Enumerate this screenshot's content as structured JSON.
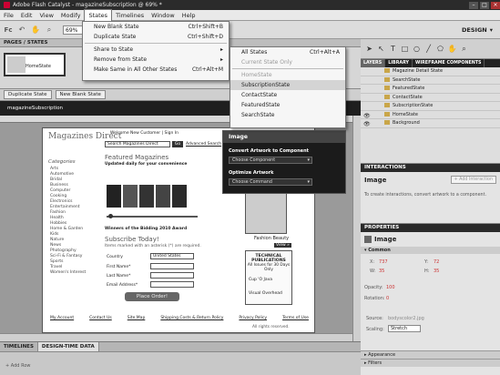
{
  "title_bar": {
    "text": "Adobe Flash Catalyst - magazineSubscription @ 69% *"
  },
  "menu": [
    "File",
    "Edit",
    "View",
    "Modify",
    "States",
    "Timelines",
    "Window",
    "Help"
  ],
  "toolbar": {
    "zoom": "69%"
  },
  "workspace": {
    "label": "DESIGN"
  },
  "pages_panel": {
    "title": "PAGES / STATES",
    "thumb_label": "HomeState",
    "duplicate_label": "Duplicate State",
    "new_blank_label": "New Blank State"
  },
  "breadcrumb": {
    "text": "magazineSubscription"
  },
  "states_menu": {
    "items": [
      {
        "label": "New Blank State",
        "shortcut": "Ctrl+Shift+B"
      },
      {
        "label": "Duplicate State",
        "shortcut": "Ctrl+Shift+D"
      },
      {
        "label": "Share to State",
        "shortcut": "▸"
      },
      {
        "label": "Remove from State",
        "shortcut": "▸"
      },
      {
        "label": "Make Same in All Other States",
        "shortcut": "Ctrl+Alt+M"
      }
    ]
  },
  "share_submenu": {
    "items": [
      {
        "label": "All States",
        "shortcut": "Ctrl+Alt+A"
      },
      {
        "label": "Current State Only",
        "shortcut": ""
      },
      {
        "label": "HomeState",
        "shortcut": ""
      },
      {
        "label": "SubscriptionState",
        "shortcut": ""
      },
      {
        "label": "ContactState",
        "shortcut": ""
      },
      {
        "label": "FeaturedState",
        "shortcut": ""
      },
      {
        "label": "SearchState",
        "shortcut": ""
      }
    ]
  },
  "hud": {
    "title": "Image",
    "convert_label": "Convert Artwork to Component",
    "convert_select": "Choose Component",
    "optimize_label": "Optimize Artwork",
    "optimize_select": "Choose Command"
  },
  "canvas": {
    "logo": "Magazines Direct",
    "welcome": "Welcome  New Customer | Sign In",
    "search_placeholder": "Search Magazines Direct",
    "go": "Go",
    "advanced": "Advanced Search",
    "featured": "Featured Magazines",
    "featured_sub": "Updated daily for your convenience",
    "categories_title": "Categories",
    "categories": [
      "Arts",
      "Automotive",
      "Bridal",
      "Business",
      "Computer",
      "Cooking",
      "Electronics",
      "Entertainment",
      "Fashion",
      "Health",
      "Hobbies",
      "Home & Garden",
      "Kids",
      "Nature",
      "News",
      "Photography",
      "Sci-Fi & Fantasy",
      "Sports",
      "Travel",
      "Women's Interest"
    ],
    "subscribe_title": "Subscribe Today!",
    "subscribe_note": "Items marked with an asterisk (*) are required.",
    "country_label": "Country",
    "country_value": "United States",
    "first_label": "First Name*",
    "last_label": "Last Name*",
    "email_label": "Email Address*",
    "order_btn": "Place Order!",
    "winner": "Winners of the Bidding 2010 Award",
    "fashion_caption": "Fashion Beauty",
    "view": "View »",
    "tech_title": "TECHNICAL PUBLICATIONS",
    "tech_sub": "All Issues for 30 Days Only",
    "tech_cup": "Cup 'O Java",
    "visual": "Visual Overhead",
    "footer_links": [
      "My Account",
      "Contact Us",
      "Site Map",
      "Shipping Costs & Return Policy",
      "Privacy Policy",
      "Terms of Use"
    ],
    "copyright": "All rights reserved."
  },
  "bottom_tabs": [
    "TIMELINES",
    "DESIGN-TIME DATA"
  ],
  "bottom_button": "Add Row",
  "layers": {
    "tabs": [
      "LAYERS",
      "LIBRARY",
      "WIREFRAME COMPONENTS"
    ],
    "rows": [
      "Magazine Detail State",
      "SearchState",
      "FeaturedState",
      "ContactState",
      "SubscriptionState",
      "HomeState",
      "Background"
    ]
  },
  "interactions": {
    "header": "INTERACTIONS",
    "title": "Image",
    "add_btn": "+ Add Interaction",
    "hint": "To create interactions, convert artwork to a component."
  },
  "properties": {
    "header": "PROPERTIES",
    "title": "Image",
    "common": "Common",
    "x_label": "X:",
    "x": "737",
    "y_label": "Y:",
    "y": "72",
    "w_label": "W:",
    "w": "35",
    "h_label": "H:",
    "h": "35",
    "opacity_label": "Opacity:",
    "opacity": "100",
    "rotation_label": "Rotation:",
    "rotation": "0",
    "source_label": "Source:",
    "source": "bodyscolor2.jpg",
    "scaling_label": "Scaling:",
    "scaling": "Stretch",
    "appearance": "Appearance",
    "filters": "Filters"
  }
}
